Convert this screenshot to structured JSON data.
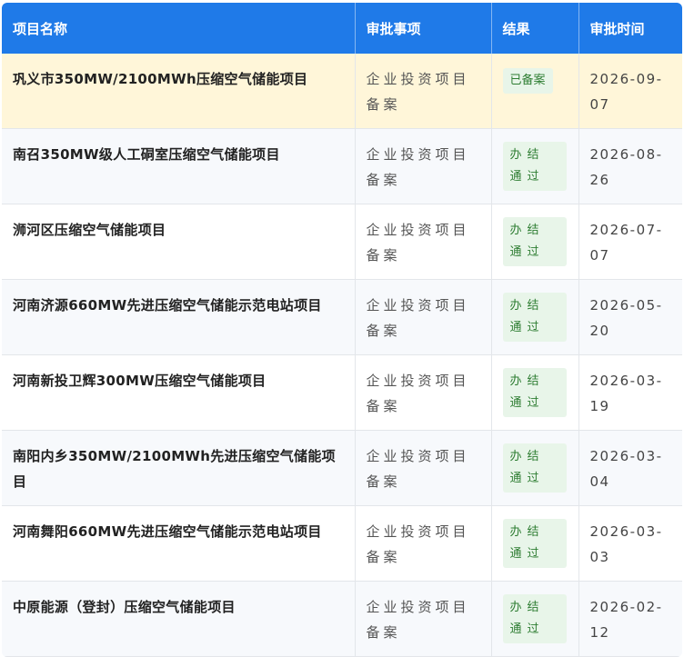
{
  "table": {
    "headers": [
      "项目名称",
      "审批事项",
      "结果",
      "审批时间"
    ],
    "rows": [
      {
        "name": "巩义市350MW/2100MWh压缩空气储能项目",
        "item": "企业投资项目备案",
        "result": "已备案",
        "date": "2026-09-07"
      },
      {
        "name": "南召350MW级人工硐室压缩空气储能项目",
        "item": "企业投资项目备案",
        "result": "办结通过",
        "date": "2026-08-26"
      },
      {
        "name": "浉河区压缩空气储能项目",
        "item": "企业投资项目备案",
        "result": "办结通过",
        "date": "2026-07-07"
      },
      {
        "name": "河南济源660MW先进压缩空气储能示范电站项目",
        "item": "企业投资项目备案",
        "result": "办结通过",
        "date": "2026-05-20"
      },
      {
        "name": "河南新投卫辉300MW压缩空气储能项目",
        "item": "企业投资项目备案",
        "result": "办结通过",
        "date": "2026-03-19"
      },
      {
        "name": "南阳内乡350MW/2100MWh先进压缩空气储能项目",
        "item": "企业投资项目备案",
        "result": "办结通过",
        "date": "2026-03-04"
      },
      {
        "name": "河南舞阳660MW先进压缩空气储能示范电站项目",
        "item": "企业投资项目备案",
        "result": "办结通过",
        "date": "2026-03-03"
      },
      {
        "name": "中原能源（登封）压缩空气储能项目",
        "item": "企业投资项目备案",
        "result": "办结通过",
        "date": "2026-02-12"
      }
    ]
  },
  "colors": {
    "header": "#1f7ae8",
    "highlight_row": "#fff6d9",
    "badge_bg": "#e8f5e9",
    "badge_text": "#2e7d32"
  }
}
